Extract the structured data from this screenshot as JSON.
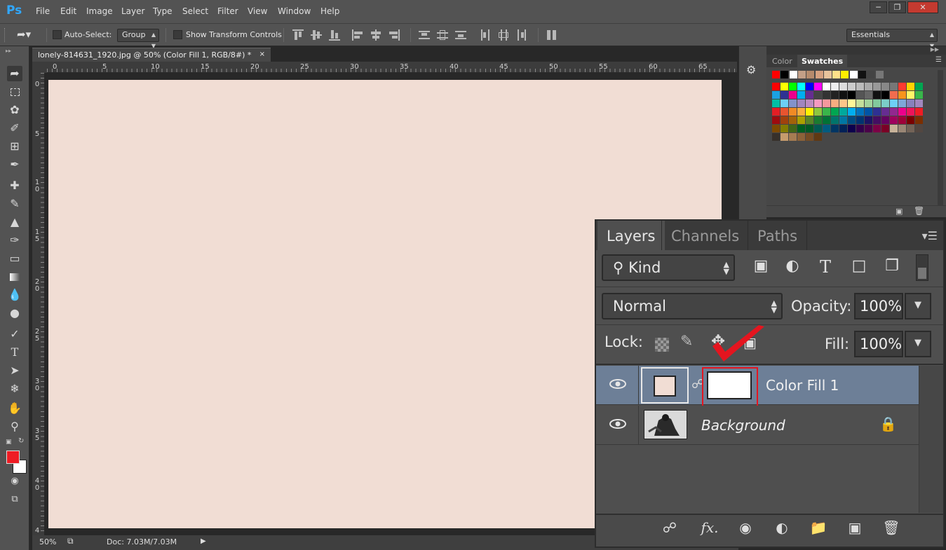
{
  "app": {
    "logo": "Ps",
    "menu": [
      "File",
      "Edit",
      "Image",
      "Layer",
      "Type",
      "Select",
      "Filter",
      "View",
      "Window",
      "Help"
    ],
    "window_controls": [
      "minimize",
      "restore",
      "close"
    ]
  },
  "options_bar": {
    "auto_select_label": "Auto-Select:",
    "auto_select_checked": false,
    "auto_select_value": "Group",
    "show_transform_label": "Show Transform Controls",
    "show_transform_checked": false,
    "workspace": "Essentials"
  },
  "document": {
    "tab_title": "lonely-814631_1920.jpg @ 50% (Color Fill 1, RGB/8#) *",
    "ruler_top": [
      "0",
      "5",
      "10",
      "15",
      "20",
      "25",
      "30",
      "35",
      "40",
      "45",
      "50",
      "55",
      "60",
      "65"
    ],
    "ruler_left": [
      "0",
      "5",
      "1 0",
      "1 5",
      "2 0",
      "2 5",
      "3 0",
      "3 5",
      "4 0",
      "4"
    ],
    "canvas_color": "#f1ddd4",
    "zoom": "50%",
    "doc_info": "Doc: 7.03M/7.03M"
  },
  "toolbar": {
    "foreground_color": "#ee1c24",
    "background_color": "#ffffff"
  },
  "swatches_panel": {
    "tabs": [
      "Color",
      "Swatches"
    ],
    "active_tab": "Swatches"
  },
  "layers_panel": {
    "tabs": [
      "Layers",
      "Channels",
      "Paths"
    ],
    "active_tab": "Layers",
    "filter_kind": "Kind",
    "blend_mode": "Normal",
    "opacity_label": "Opacity:",
    "opacity": "100%",
    "lock_label": "Lock:",
    "fill_label": "Fill:",
    "fill": "100%",
    "layers": [
      {
        "name": "Color Fill 1",
        "selected": true,
        "visible": true,
        "locked": false
      },
      {
        "name": "Background",
        "selected": false,
        "visible": true,
        "locked": true
      }
    ],
    "highlight_color": "#e4151f"
  }
}
